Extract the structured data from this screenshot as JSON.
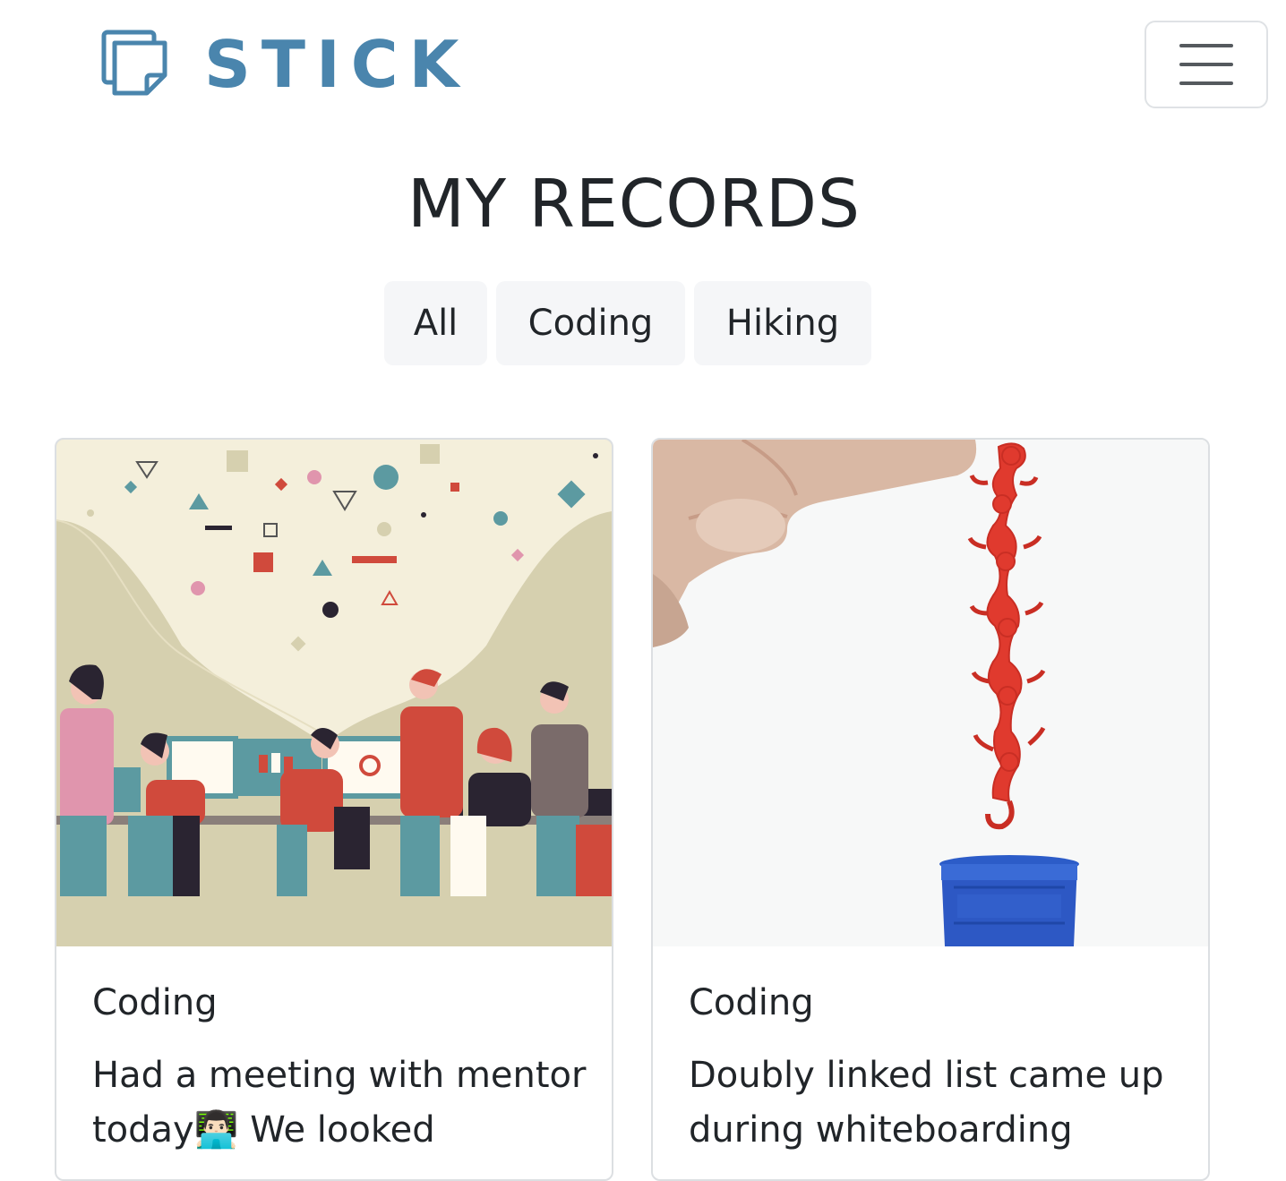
{
  "brand": {
    "name": "STICK",
    "color": "#4a85ad"
  },
  "header": {
    "menu_icon": "hamburger-menu-icon"
  },
  "page": {
    "title": "MY RECORDS"
  },
  "filters": [
    {
      "label": "All"
    },
    {
      "label": "Coding"
    },
    {
      "label": "Hiking"
    }
  ],
  "cards": [
    {
      "category": "Coding",
      "text": "Had a meeting with mentor today👨🏻‍💻 We looked",
      "image": "team-meeting-illustration"
    },
    {
      "category": "Coding",
      "text": "Doubly linked list came up during whiteboarding",
      "image": "barrel-of-monkeys-photo"
    }
  ]
}
